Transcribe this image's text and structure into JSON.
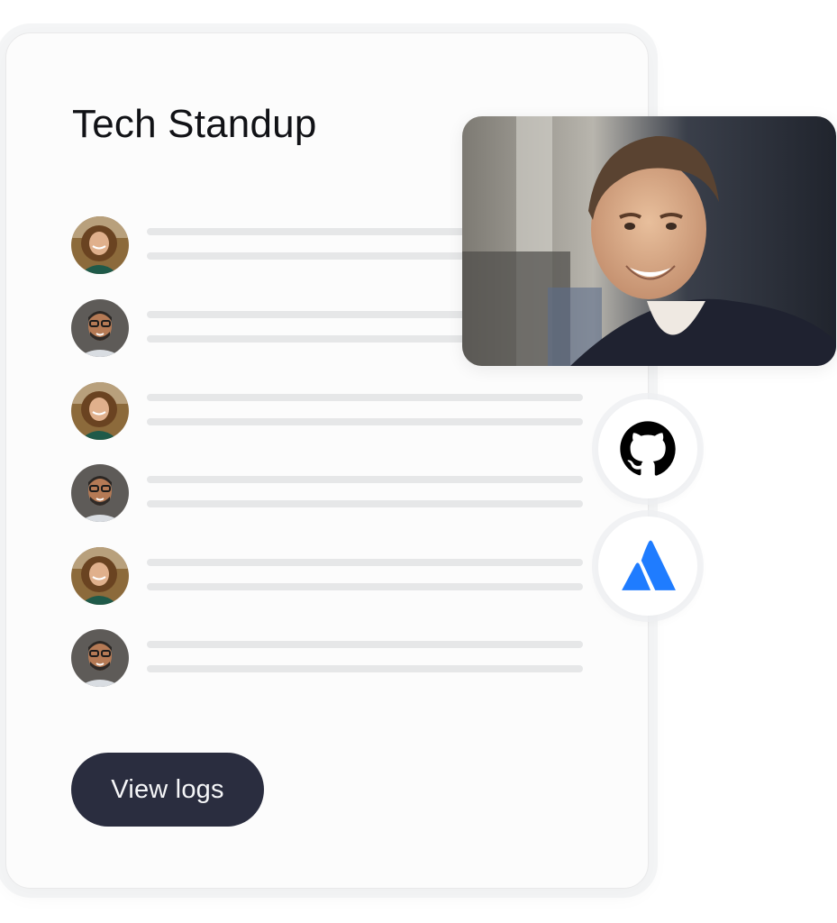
{
  "card": {
    "title": "Tech Standup",
    "button_label": "View logs"
  },
  "participants": [
    {
      "avatar": "woman-curly-hair-avatar"
    },
    {
      "avatar": "man-glasses-beard-avatar"
    },
    {
      "avatar": "woman-curly-hair-avatar"
    },
    {
      "avatar": "man-glasses-beard-avatar"
    },
    {
      "avatar": "woman-curly-hair-avatar"
    },
    {
      "avatar": "man-glasses-beard-avatar"
    }
  ],
  "video_tile": {
    "subject": "smiling-man-video-feed"
  },
  "integrations": [
    {
      "icon": "github-icon",
      "color": "#000000"
    },
    {
      "icon": "atlassian-icon",
      "color": "#1f7cff"
    }
  ],
  "colors": {
    "button_bg": "#2a2d3f",
    "skeleton_line": "#e6e7e8",
    "card_bg": "#fcfcfc"
  }
}
